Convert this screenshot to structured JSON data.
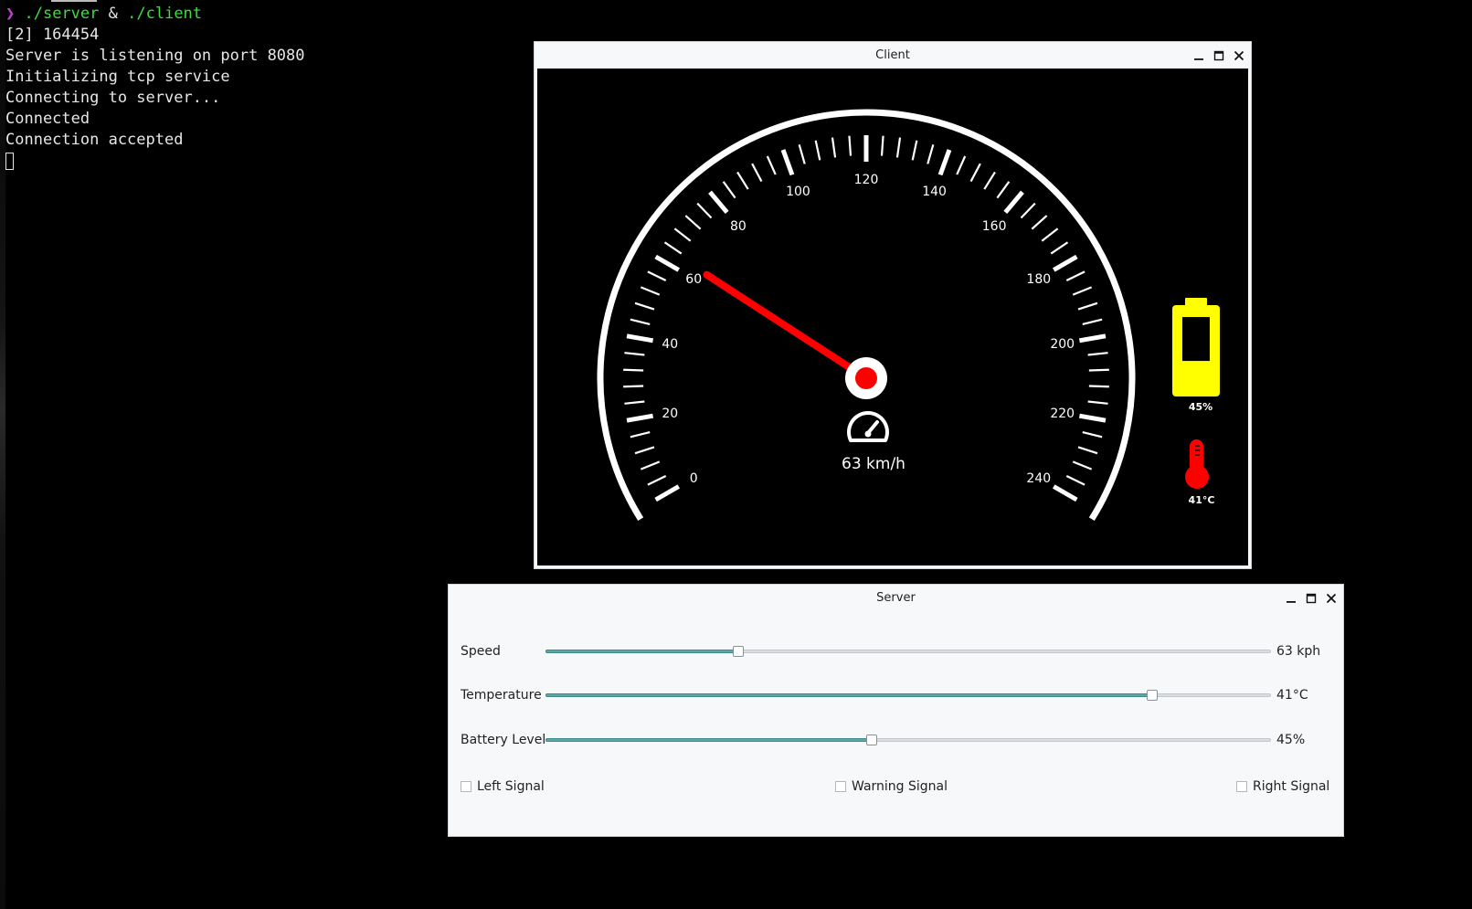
{
  "terminal": {
    "prompt_glyph": "❯",
    "command_server": "./server",
    "command_op": "&",
    "command_client": "./client",
    "lines": [
      "[2] 164454",
      "Server is listening on port 8080",
      "Initializing tcp service",
      "Connecting to server...",
      "Connected",
      "Connection accepted"
    ]
  },
  "client": {
    "title": "Client",
    "gauge": {
      "min": 0,
      "max": 240,
      "major_labels": [
        "0",
        "20",
        "40",
        "60",
        "80",
        "100",
        "120",
        "140",
        "160",
        "180",
        "200",
        "220",
        "240"
      ],
      "speed_value": 63,
      "speed_text": "63 km/h",
      "needle_color": "#ff0000",
      "speedometer_icon": "speedometer-icon"
    },
    "battery": {
      "icon": "battery-icon",
      "level": 0.45,
      "text": "45%",
      "color": "#ffff00"
    },
    "temperature": {
      "icon": "thermometer-icon",
      "text": "41°C",
      "color": "#ff0000"
    }
  },
  "server": {
    "title": "Server",
    "sliders": [
      {
        "label": "Speed",
        "value_text": "63 kph",
        "fraction": 0.265
      },
      {
        "label": "Temperature",
        "value_text": "41°C",
        "fraction": 0.837
      },
      {
        "label": "Battery Level",
        "value_text": "45%",
        "fraction": 0.45
      }
    ],
    "checkboxes": [
      {
        "label": "Left Signal",
        "checked": false
      },
      {
        "label": "Warning Signal",
        "checked": false
      },
      {
        "label": "Right Signal",
        "checked": false
      }
    ]
  },
  "window_controls": {
    "minimize_icon": "minimize-icon",
    "maximize_icon": "maximize-icon",
    "close_icon": "close-icon"
  },
  "colors": {
    "slider_fill": "#5ba8a8",
    "terminal_command": "#3ddc3d",
    "terminal_prompt": "#c640d8"
  }
}
